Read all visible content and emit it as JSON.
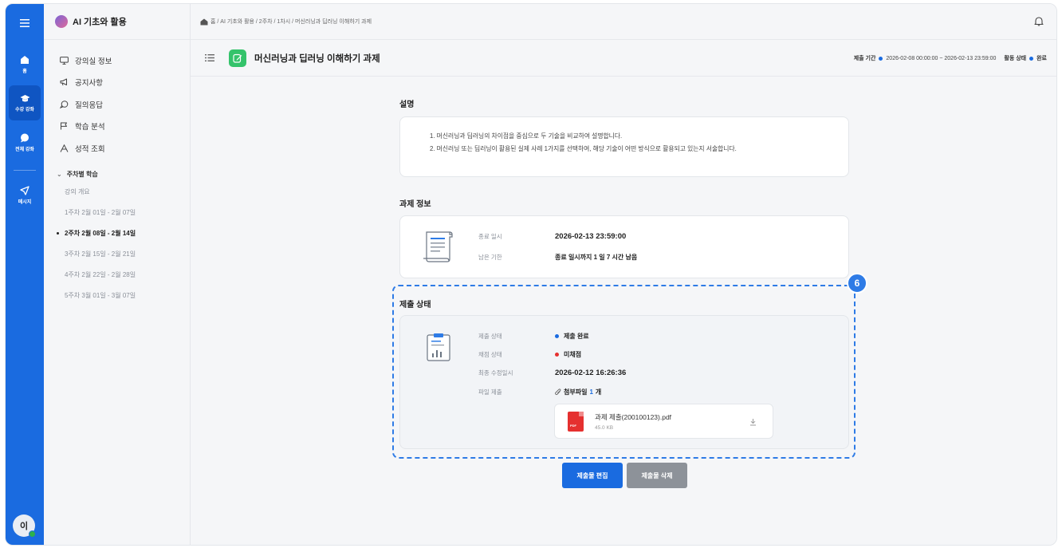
{
  "rail": {
    "items": [
      {
        "label": "홈"
      },
      {
        "label": "수강 강좌"
      },
      {
        "label": "전체 강좌"
      },
      {
        "label": "메시지"
      }
    ],
    "avatar": "이"
  },
  "sidebar": {
    "course_title": "AI 기초와 활용",
    "menu": [
      {
        "label": "강의실 정보"
      },
      {
        "label": "공지사항"
      },
      {
        "label": "질의응답"
      },
      {
        "label": "학습 분석"
      },
      {
        "label": "성적 조회"
      }
    ],
    "week_section": "주차별 학습",
    "weeks": [
      {
        "label": "강의 개요"
      },
      {
        "label": "1주차 2월 01일 - 2월 07일"
      },
      {
        "label": "2주차 2월 08일 - 2월 14일"
      },
      {
        "label": "3주차 2월 15일 - 2월 21일"
      },
      {
        "label": "4주차 2월 22일 - 2월 28일"
      },
      {
        "label": "5주차 3월 01일 - 3월 07일"
      }
    ]
  },
  "breadcrumb": "홈 / AI 기초와 활용 / 2주차 / 1차시 / 머신러닝과 딥러닝 이해하기 과제",
  "page": {
    "title": "머신러닝과 딥러닝 이해하기 과제",
    "meta_period_label": "제출 기간",
    "meta_period": "2026-02-08 00:00:00 ~ 2026-02-13 23:59:00",
    "meta_status_label": "활동 상태",
    "meta_status": "완료",
    "status_color": "#1a6be0"
  },
  "description": {
    "title": "설명",
    "lines": [
      "1. 머신러닝과 딥러닝의 차이점을 중심으로 두 기술을 비교하여 설명합니다.",
      "2. 머신러닝 또는 딥러닝이 활용된 실제 사례 1가지를 선택하여, 해당 기술이 어떤 방식으로 활용되고 있는지 서술합니다."
    ]
  },
  "assignment_info": {
    "title": "과제 정보",
    "due_label": "종료 일시",
    "due_value": "2026-02-13 23:59:00",
    "remaining_label": "남은 기한",
    "remaining_value": "종료 일시까지 1 일 7 시간 남음"
  },
  "submission": {
    "title": "제출 상태",
    "callout": "6",
    "status_label": "제출 상태",
    "status_value": "제출 완료",
    "status_color": "#1a6be0",
    "grade_label": "채점 상태",
    "grade_value": "미채점",
    "grade_color": "#e5302f",
    "modified_label": "최종 수정일시",
    "modified_value": "2026-02-12 16:26:36",
    "file_label": "파일 제출",
    "file_prefix": "첨부파일",
    "file_count": "1",
    "file_suffix": "개",
    "file": {
      "icon_text": "PDF",
      "name": "과제 제출(200100123).pdf",
      "size": "45.0 KB"
    }
  },
  "buttons": {
    "edit": "제출물 편집",
    "delete": "제출물 삭제"
  }
}
